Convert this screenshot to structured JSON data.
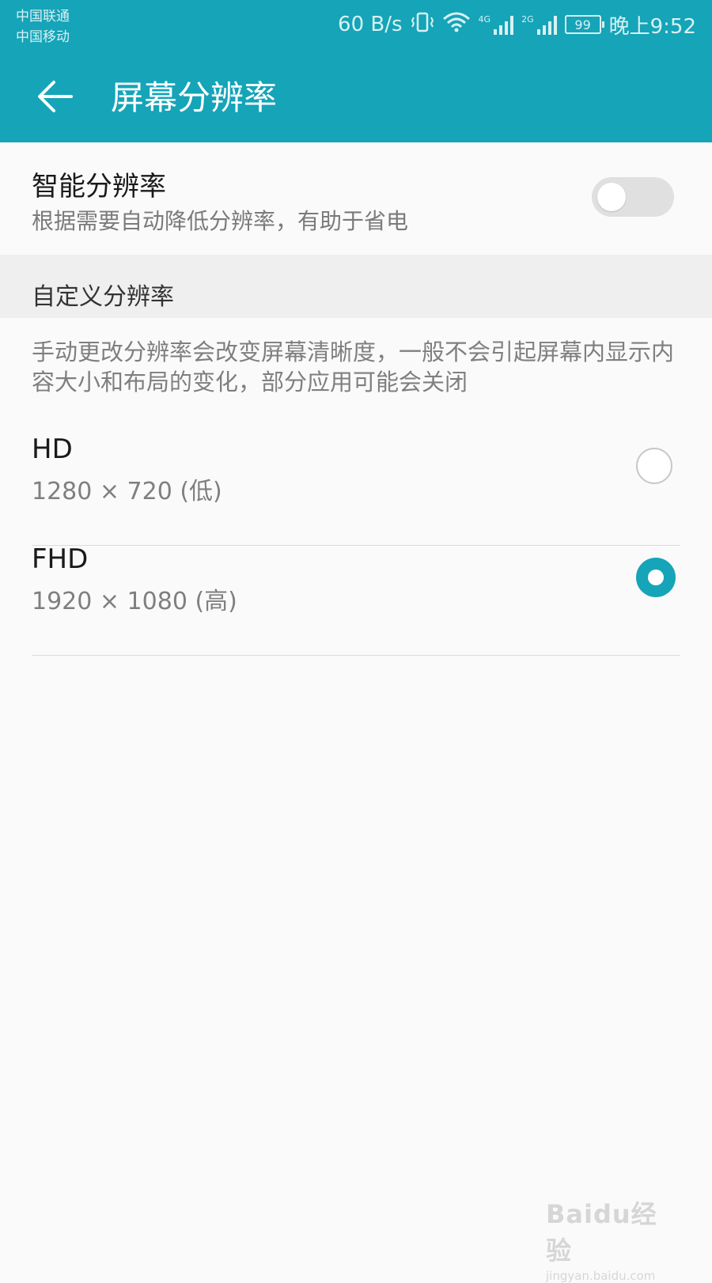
{
  "status_bar": {
    "carrier1": "中国联通",
    "carrier2": "中国移动",
    "net_speed": "60 B/s",
    "sim1_tag": "4G",
    "sim2_tag": "2G",
    "battery": "99",
    "time": "晚上9:52"
  },
  "app_bar": {
    "title": "屏幕分辨率"
  },
  "smart_resolution": {
    "title": "智能分辨率",
    "subtitle": "根据需要自动降低分辨率，有助于省电",
    "enabled": false
  },
  "custom_section": {
    "title": "自定义分辨率",
    "description": "手动更改分辨率会改变屏幕清晰度，一般不会引起屏幕内显示内容大小和布局的变化，部分应用可能会关闭"
  },
  "options": [
    {
      "name": "HD",
      "resolution": "1280 × 720 (低)",
      "selected": false
    },
    {
      "name": "FHD",
      "resolution": "1920 × 1080 (高)",
      "selected": true
    }
  ],
  "watermark": {
    "logo": "Baidu经验",
    "url": "jingyan.baidu.com"
  },
  "colors": {
    "accent": "#15a4b8",
    "background": "#fafafa",
    "section_bg": "#efefef"
  }
}
